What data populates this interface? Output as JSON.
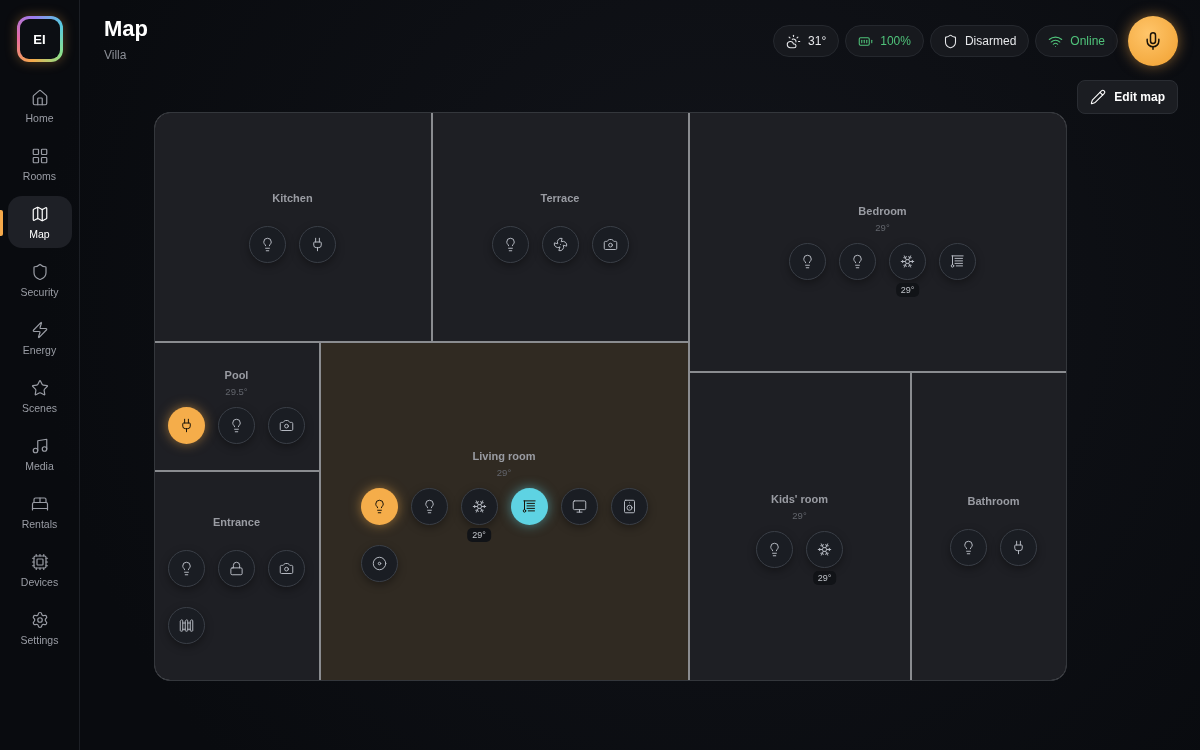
{
  "logo": {
    "text": "EI"
  },
  "sidebar": {
    "items": [
      {
        "kind": "home",
        "label": "Home",
        "selected": false
      },
      {
        "kind": "rooms",
        "label": "Rooms",
        "selected": false
      },
      {
        "kind": "map",
        "label": "Map",
        "selected": true
      },
      {
        "kind": "security",
        "label": "Security",
        "selected": false
      },
      {
        "kind": "energy",
        "label": "Energy",
        "selected": false
      },
      {
        "kind": "scenes",
        "label": "Scenes",
        "selected": false
      },
      {
        "kind": "media",
        "label": "Media",
        "selected": false
      },
      {
        "kind": "rentals",
        "label": "Rentals",
        "selected": false
      },
      {
        "kind": "devices",
        "label": "Devices",
        "selected": false
      },
      {
        "kind": "settings",
        "label": "Settings",
        "selected": false
      }
    ]
  },
  "header": {
    "title": "Map",
    "subtitle": "Villa"
  },
  "status": [
    {
      "kind": "weather",
      "text": "31°",
      "color": "#e6e7ea"
    },
    {
      "kind": "battery",
      "text": "100%",
      "color": "#4fc27a"
    },
    {
      "kind": "security",
      "text": "Disarmed",
      "color": "#e6e7ea"
    },
    {
      "kind": "network",
      "text": "Online",
      "color": "#4fc27a"
    }
  ],
  "edit_button": {
    "label": "Edit map"
  },
  "rooms": [
    {
      "name": "Kitchen",
      "selected": false,
      "devices": [
        {
          "kind": "light",
          "on": false
        },
        {
          "kind": "plug",
          "on": false
        }
      ]
    },
    {
      "name": "Terrace",
      "selected": false,
      "devices": [
        {
          "kind": "light",
          "on": false
        },
        {
          "kind": "fan",
          "on": false
        },
        {
          "kind": "camera",
          "on": false
        }
      ]
    },
    {
      "name": "Bedroom",
      "temperature": "29°",
      "selected": false,
      "devices": [
        {
          "kind": "light",
          "on": false
        },
        {
          "kind": "light",
          "on": false
        },
        {
          "kind": "ac",
          "on": false,
          "reading": "29°"
        },
        {
          "kind": "curtain",
          "on": false
        }
      ]
    },
    {
      "name": "Pool",
      "temperature": "29.5°",
      "selected": false,
      "devices": [
        {
          "kind": "plug",
          "on": true
        },
        {
          "kind": "light",
          "on": false
        },
        {
          "kind": "camera",
          "on": false
        }
      ]
    },
    {
      "name": "Entrance",
      "selected": false,
      "devices": [
        {
          "kind": "light",
          "on": false
        },
        {
          "kind": "lock",
          "on": false
        },
        {
          "kind": "camera",
          "on": false
        },
        {
          "kind": "gate",
          "on": false
        }
      ]
    },
    {
      "name": "Living room",
      "temperature": "29°",
      "selected": true,
      "devices": [
        {
          "kind": "light",
          "on": true
        },
        {
          "kind": "light",
          "on": false
        },
        {
          "kind": "ac",
          "on": false,
          "reading": "29°"
        },
        {
          "kind": "curtain",
          "on": true
        },
        {
          "kind": "tv",
          "on": false
        },
        {
          "kind": "speaker",
          "on": false
        },
        {
          "kind": "vacuum",
          "on": false
        }
      ]
    },
    {
      "name": "Kids' room",
      "temperature": "29°",
      "selected": false,
      "devices": [
        {
          "kind": "light",
          "on": false
        },
        {
          "kind": "ac",
          "on": false,
          "reading": "29°"
        }
      ]
    },
    {
      "name": "Bathroom",
      "selected": false,
      "devices": [
        {
          "kind": "light",
          "on": false
        },
        {
          "kind": "plug",
          "on": false
        }
      ]
    }
  ]
}
